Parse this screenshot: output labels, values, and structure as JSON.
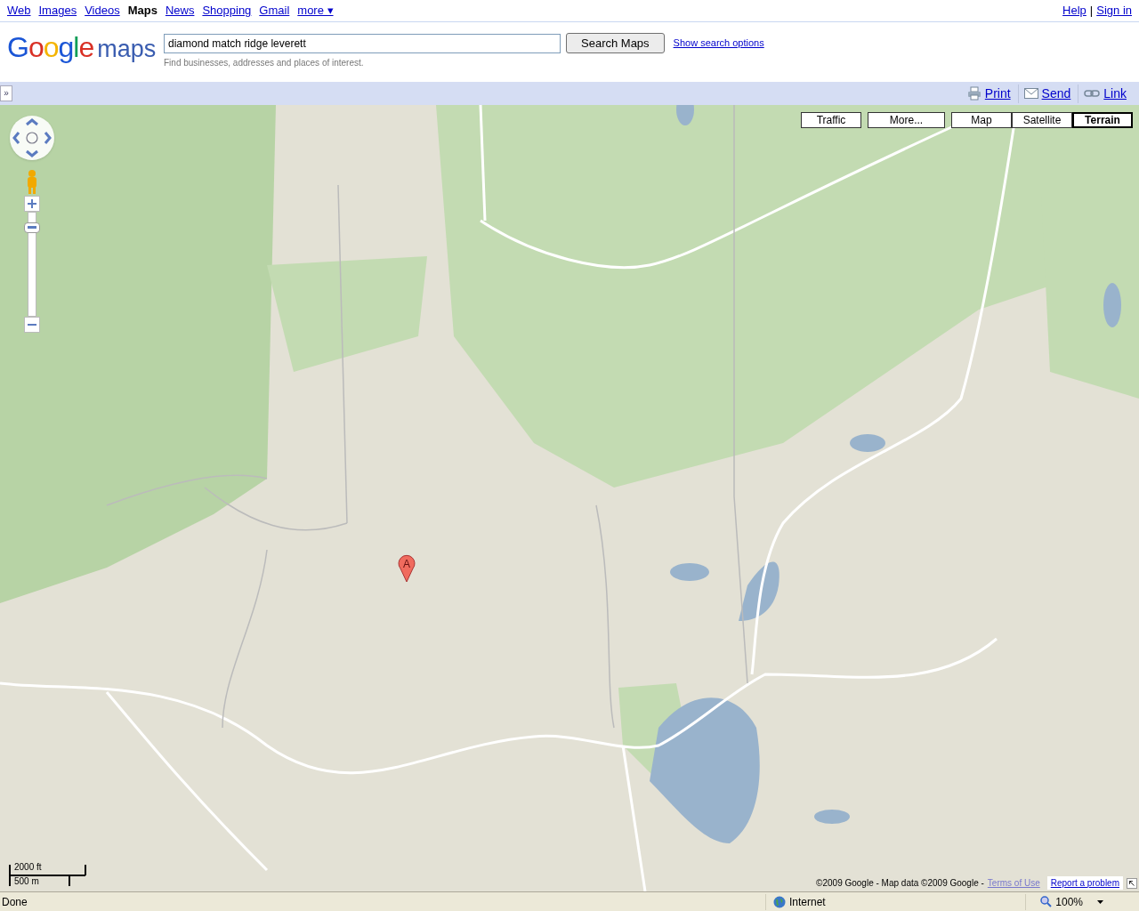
{
  "top_nav": {
    "links": [
      {
        "label": "Web",
        "selected": false
      },
      {
        "label": "Images",
        "selected": false
      },
      {
        "label": "Videos",
        "selected": false
      },
      {
        "label": "Maps",
        "selected": true
      },
      {
        "label": "News",
        "selected": false
      },
      {
        "label": "Shopping",
        "selected": false
      },
      {
        "label": "Gmail",
        "selected": false
      },
      {
        "label": "more ▾",
        "selected": false
      }
    ],
    "right_links": [
      "Help",
      "Sign in"
    ],
    "separator": "|"
  },
  "header": {
    "logo_google": "Google",
    "logo_product": "maps",
    "search": {
      "value": "diamond match ridge leverett"
    },
    "search_button": "Search Maps",
    "options_link": "Show search options",
    "hint": "Find businesses, addresses and places of interest."
  },
  "toolbar": {
    "collapse": "»",
    "actions": [
      {
        "kind": "print",
        "label": "Print"
      },
      {
        "kind": "send",
        "label": "Send"
      },
      {
        "kind": "link",
        "label": "Link"
      }
    ]
  },
  "map": {
    "overlay_buttons": [
      "Traffic",
      "More..."
    ],
    "map_types": [
      {
        "label": "Map",
        "selected": false
      },
      {
        "label": "Satellite",
        "selected": false
      },
      {
        "label": "Terrain",
        "selected": true
      }
    ],
    "zoom": {
      "level": 0.9
    },
    "marker": "A",
    "scale": {
      "imperial": "2000 ft",
      "metric": "500 m"
    },
    "copyright": "©2009 Google - Map data ©2009 Google -",
    "terms_link": "Terms of Use",
    "report_link": "Report a problem"
  },
  "status_bar": {
    "text": "Done",
    "zone": "Internet",
    "zoom": "100%"
  }
}
